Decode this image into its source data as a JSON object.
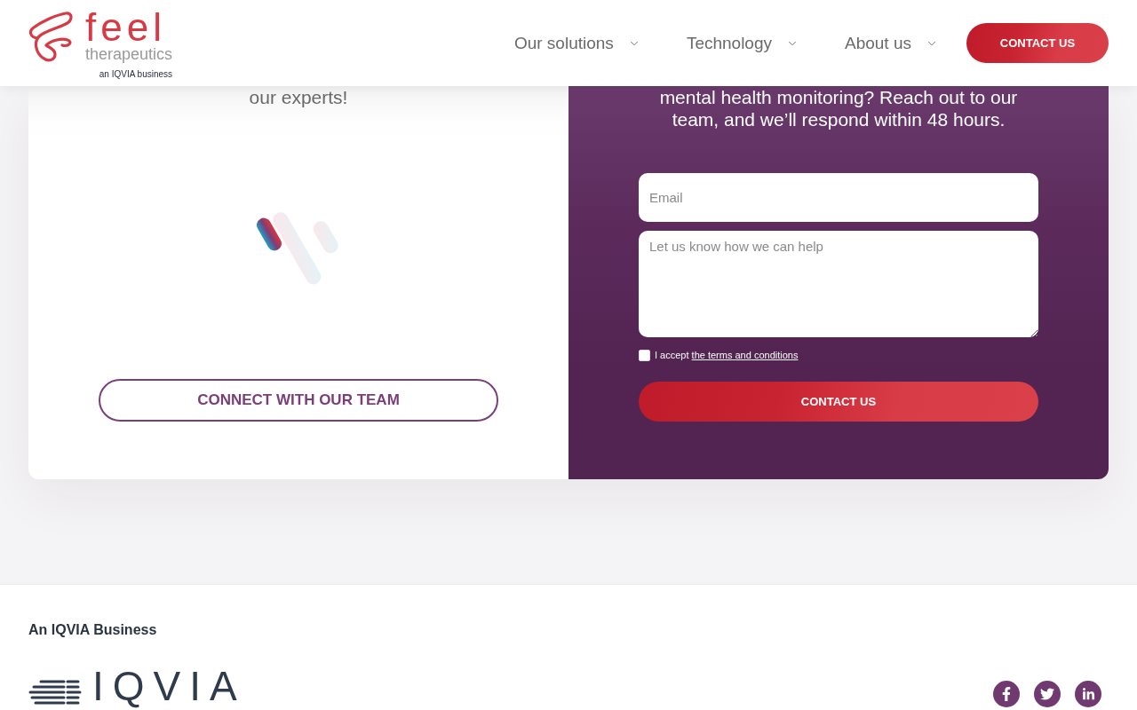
{
  "header": {
    "logo": {
      "wordmark": "feel",
      "subtitle": "therapeutics",
      "tagline": "an IQVIA business"
    },
    "nav": [
      {
        "label": "Our solutions"
      },
      {
        "label": "Technology"
      },
      {
        "label": "About us"
      }
    ],
    "cta": "CONTACT US"
  },
  "left_panel": {
    "heading_tail": "our experts!",
    "button": "CONNECT WITH OUR TEAM"
  },
  "right_panel": {
    "heading_tail": "mental health monitoring? Reach out to our team, and we’ll respond within 48 hours.",
    "form": {
      "email": {
        "placeholder": "Email"
      },
      "message": {
        "placeholder": "Let us know how we can help"
      },
      "consent": {
        "checked": false,
        "text": "I accept",
        "link": "the terms and conditions"
      },
      "submit": "CONTACT US"
    }
  },
  "footer": {
    "heading": "An IQVIA Business",
    "logo_text": "IQVIA",
    "social": [
      {
        "kind": "facebook"
      },
      {
        "kind": "twitter"
      },
      {
        "kind": "linkedin"
      }
    ]
  }
}
